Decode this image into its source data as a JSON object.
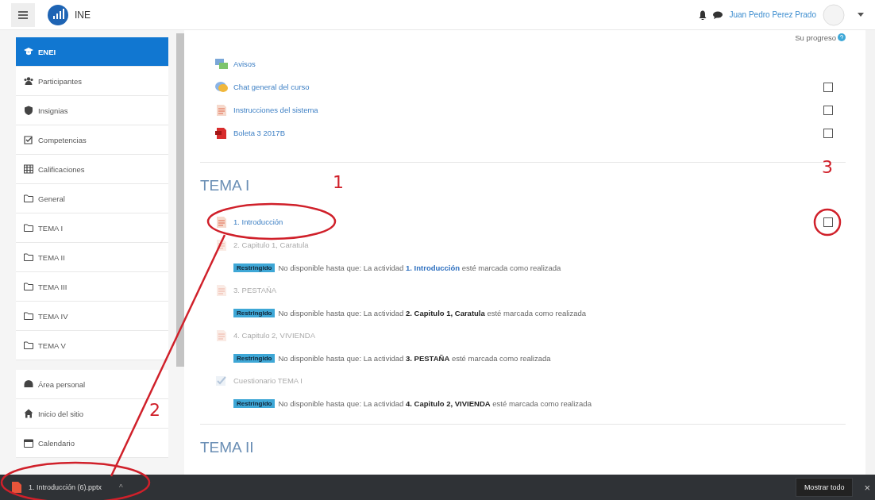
{
  "header": {
    "site_name": "INE",
    "user_name": "Juan Pedro Perez Prado"
  },
  "sidebar": {
    "groups": [
      [
        {
          "label": "ENEI",
          "kind": "course",
          "selected": true
        },
        {
          "label": "Participantes",
          "kind": "users",
          "selected": false
        },
        {
          "label": "Insignias",
          "kind": "shield",
          "selected": false
        },
        {
          "label": "Competencias",
          "kind": "checklist",
          "selected": false
        },
        {
          "label": "Calificaciones",
          "kind": "table",
          "selected": false
        },
        {
          "label": "General",
          "kind": "folder",
          "selected": false
        },
        {
          "label": "TEMA I",
          "kind": "folder",
          "selected": false
        },
        {
          "label": "TEMA II",
          "kind": "folder",
          "selected": false
        },
        {
          "label": "TEMA III",
          "kind": "folder",
          "selected": false
        },
        {
          "label": "TEMA IV",
          "kind": "folder",
          "selected": false
        },
        {
          "label": "TEMA V",
          "kind": "folder",
          "selected": false
        }
      ],
      [
        {
          "label": "Área personal",
          "kind": "dashboard",
          "selected": false
        },
        {
          "label": "Inicio del sitio",
          "kind": "home",
          "selected": false
        },
        {
          "label": "Calendario",
          "kind": "calendar",
          "selected": false
        }
      ]
    ]
  },
  "progress_label": "Su progreso",
  "sections": [
    {
      "activities": [
        {
          "name": "Avisos",
          "kind": "forum",
          "available": true
        },
        {
          "name": "Chat general del curso",
          "kind": "chat",
          "available": true,
          "checked": false
        },
        {
          "name": "Instrucciones del sistema",
          "kind": "page",
          "available": true,
          "checked": false
        },
        {
          "name": "Boleta 3 2017B",
          "kind": "pdf",
          "available": true,
          "checked": false
        }
      ]
    },
    {
      "title": "TEMA I",
      "activities": [
        {
          "name": "1. Introducción",
          "kind": "page",
          "available": true,
          "checked": false
        },
        {
          "name": "2. Capitulo 1, Caratula",
          "kind": "page",
          "available": false,
          "badge": "Restringido",
          "restriction": "No disponible hasta que: La actividad **1. Introducción** esté marcada como realizada",
          "restriction_link": true
        },
        {
          "name": "3. PESTAÑA",
          "kind": "page",
          "available": false,
          "badge": "Restringido",
          "restriction": "No disponible hasta que: La actividad **2. Capitulo 1, Caratula** esté marcada como realizada",
          "restriction_link": false
        },
        {
          "name": "4. Capitulo 2, VIVIENDA",
          "kind": "page",
          "available": false,
          "badge": "Restringido",
          "restriction": "No disponible hasta que: La actividad **3. PESTAÑA** esté marcada como realizada",
          "restriction_link": false
        },
        {
          "name": "Cuestionario TEMA I",
          "kind": "quiz",
          "available": false,
          "badge": "Restringido",
          "restriction": "No disponible hasta que: La actividad **4. Capitulo 2, VIVIENDA** esté marcada como realizada",
          "restriction_link": false
        }
      ]
    },
    {
      "title": "TEMA II"
    }
  ],
  "download_bar": {
    "file_name": "1. Introducción (6).pptx",
    "caret": "^",
    "show_all": "Mostrar todo",
    "close": "×"
  },
  "annotations": [
    "1",
    "2",
    "3"
  ]
}
